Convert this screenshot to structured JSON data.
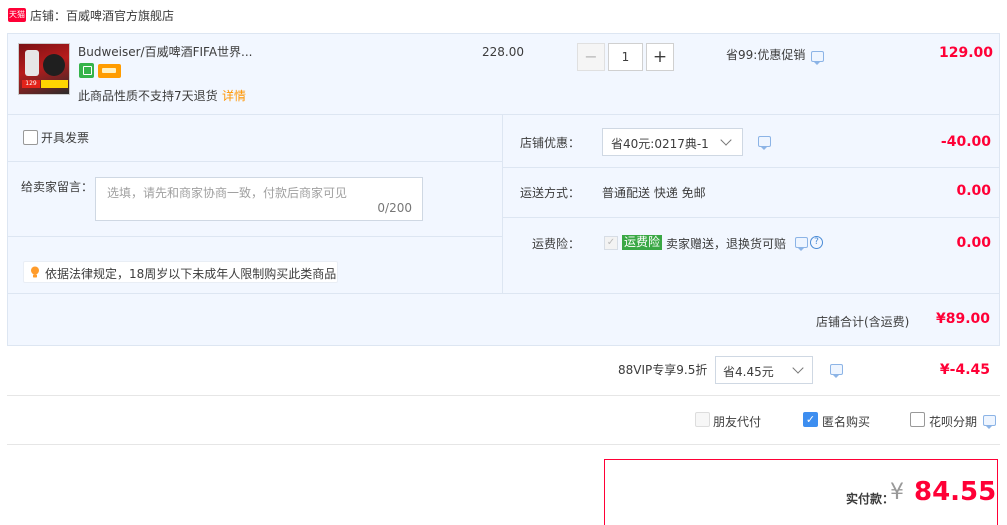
{
  "store": {
    "badge": "天猫",
    "label": "店铺：百威啤酒官方旗舰店"
  },
  "item": {
    "title": "Budweiser/百威啤酒FIFA世界...",
    "thumb_tag": "129",
    "return_note": "此商品性质不支持7天退货",
    "return_detail": "详情",
    "unit_price": "228.00",
    "quantity": "1",
    "minus": "−",
    "plus": "+",
    "promo": "省99:优惠促销",
    "total": "129.00"
  },
  "options": {
    "invoice_label": "开具发票",
    "memo_label": "给卖家留言：",
    "memo_placeholder": "选填，请先和商家协商一致，付款后商家可见",
    "memo_count": "0/200",
    "notice": "依据法律规定，18周岁以下未成年人限制购买此类商品",
    "shop_discount_label": "店铺优惠：",
    "coupon_selected": "省40元:0217典-1",
    "shop_discount": "-40.00",
    "shipping_label": "运送方式：",
    "shipping_method": "普通配送 快递 免邮",
    "shipping_fee": "0.00",
    "insurance_label": "运费险：",
    "insurance_check": "✓",
    "insurance_tag": "运费险",
    "insurance_desc": "卖家赠送，退换货可赔",
    "insurance_help": "?",
    "insurance_fee": "0.00",
    "shop_total_label": "店铺合计(含运费)",
    "shop_total": "¥89.00"
  },
  "vip": {
    "label": "88VIP专享9.5折",
    "selected": "省4.45元",
    "amount": "¥-4.45"
  },
  "pay_options": {
    "friend_label": "朋友代付",
    "anonymous_check": "✓",
    "anonymous_label": "匿名购买",
    "anonymous_checked": true,
    "huabei_label": "花呗分期"
  },
  "payment": {
    "label": "实付款：",
    "currency": "¥",
    "amount": "84.55"
  },
  "colors": {
    "price_red": "#ff0036",
    "panel_bg": "#f2f7ff",
    "link_orange": "#ff9500",
    "insurance_green": "#3aa845",
    "check_blue": "#3d8ef0"
  }
}
